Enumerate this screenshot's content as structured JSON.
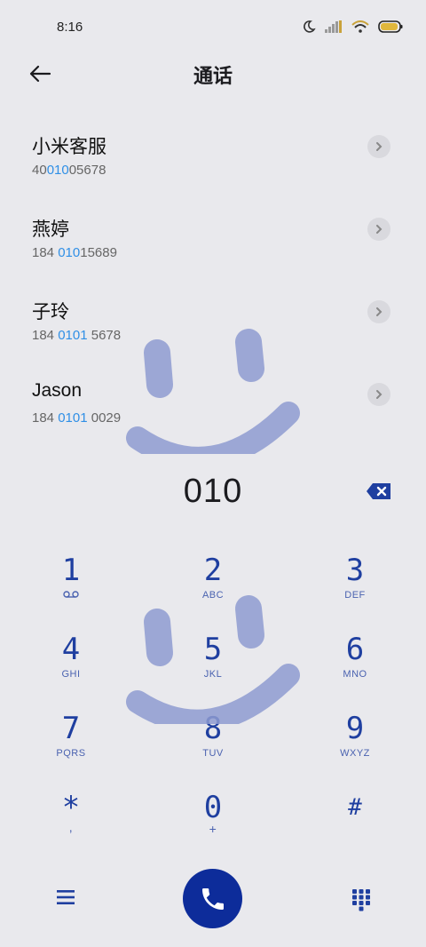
{
  "status": {
    "time": "8:16"
  },
  "header": {
    "title": "通话"
  },
  "contacts": [
    {
      "name": "小米客服",
      "num_pre": "40",
      "num_hl": "010",
      "num_post": "05678"
    },
    {
      "name": "燕婷",
      "num_pre": "184 ",
      "num_hl": "010",
      "num_post": "15689"
    },
    {
      "name": "子玲",
      "num_pre": "184 ",
      "num_hl": "0101",
      "num_post": " 5678"
    },
    {
      "name": "Jason",
      "num_pre": "184 ",
      "num_hl": "0101",
      "num_post": " 0029"
    }
  ],
  "dial": {
    "number": "010"
  },
  "keypad": [
    {
      "digit": "1",
      "sub": "voicemail"
    },
    {
      "digit": "2",
      "sub": "ABC"
    },
    {
      "digit": "3",
      "sub": "DEF"
    },
    {
      "digit": "4",
      "sub": "GHI"
    },
    {
      "digit": "5",
      "sub": "JKL"
    },
    {
      "digit": "6",
      "sub": "MNO"
    },
    {
      "digit": "7",
      "sub": "PQRS"
    },
    {
      "digit": "8",
      "sub": "TUV"
    },
    {
      "digit": "9",
      "sub": "WXYZ"
    },
    {
      "digit": "*",
      "sub": ","
    },
    {
      "digit": "0",
      "sub": "+"
    },
    {
      "digit": "#",
      "sub": ""
    }
  ],
  "colors": {
    "accent": "#0d2c9a",
    "highlight": "#2f8fe6",
    "keypad": "#1f3fa0",
    "watermark": "#8e9bd0"
  },
  "icons": {
    "back": "arrow-left-icon",
    "menu": "hamburger-menu-icon",
    "call": "phone-icon",
    "dialpad": "dialpad-icon",
    "backspace": "backspace-icon"
  }
}
